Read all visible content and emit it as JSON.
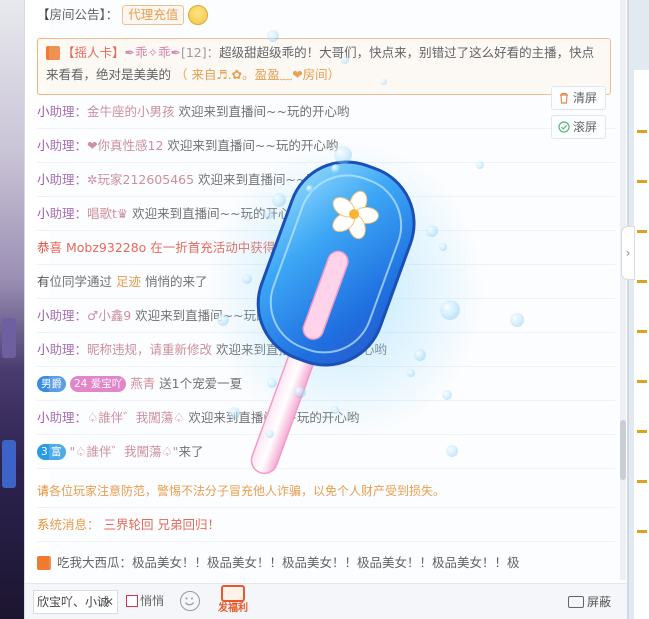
{
  "announcement": {
    "label": "【房间公告】：",
    "tag": "代理充值"
  },
  "shake_card": {
    "title": "【摇人卡】",
    "sender": "✒乖✧乖✒",
    "count": "[12]：",
    "text": "超级甜超级乖的！大哥们，快点来，别错过了这么好看的主播，快点来看看，绝对是美美的",
    "from": "（ 来自♬.✿。盈盈﹏❤房间）"
  },
  "side_buttons": {
    "clear": "清屏",
    "scroll": "滚屏"
  },
  "messages": [
    {
      "prefix": "小助理：",
      "nick": "金牛座的小男孩",
      "text": " 欢迎来到直播间~~玩的开心哟"
    },
    {
      "prefix": "小助理：",
      "nick": "❤你真性感12",
      "text": " 欢迎来到直播间~~玩的开心哟"
    },
    {
      "prefix": "小助理：",
      "nick": "✲玩家212605465",
      "text": " 欢迎来到直播间~~玩的开心哟"
    },
    {
      "prefix": "小助理：",
      "nick": "唱歌t♛",
      "text": " 欢迎来到直播间~~玩的开心哟"
    }
  ],
  "congrats": {
    "prefix": "恭喜 ",
    "nick": "Mobz93228o",
    "text": " 在一折首充活动中获得"
  },
  "visit": {
    "text": "有位同学通过 ",
    "link": "足迹",
    "tail": " 悄悄的来了"
  },
  "messages2": [
    {
      "prefix": "小助理：",
      "nick": "♂小鑫9",
      "text": " 欢迎来到直播间~~玩的开心哟"
    },
    {
      "prefix": "小助理：",
      "nick": "昵称违规，请重新修改",
      "text": " 欢迎来到直播间~~玩的开心哟"
    }
  ],
  "gift": {
    "badge1": "男爵",
    "badge2": "爱宝吖",
    "level": "24",
    "nick": "燕青",
    "text": " 送1个宠爱一夏"
  },
  "message3": {
    "prefix": "小助理：",
    "nick": "♤誰伴゛我闖蕩♤",
    "text": " 欢迎来到直播间~~玩的开心哟"
  },
  "enter": {
    "badge": "3 富",
    "nick": "\"♤誰伴゛我闖蕩♤\"",
    "text": "来了"
  },
  "warning": "请各位玩家注意防范，警惕不法分子冒充他人诈骗，以免个人财产受到损失。",
  "system": {
    "prefix": "系统消息：",
    "text": " 三界轮回 兄弟回归！"
  },
  "scroll_msg": {
    "nick": "吃我大西瓜：",
    "text": "极品美女！！极品美女！！极品美女！！极品美女！！极品美女！！极"
  },
  "input_bar": {
    "name_value": "欣宝吖、小诚",
    "anonymous_label": "悄悄",
    "fuli_label": "发福利",
    "block_label": "屏蔽"
  },
  "colors": {
    "accent_orange": "#e88c2b",
    "nick_pink": "#c77a8a",
    "prefix_purple": "#9b56a8",
    "red": "#e24b3a"
  }
}
